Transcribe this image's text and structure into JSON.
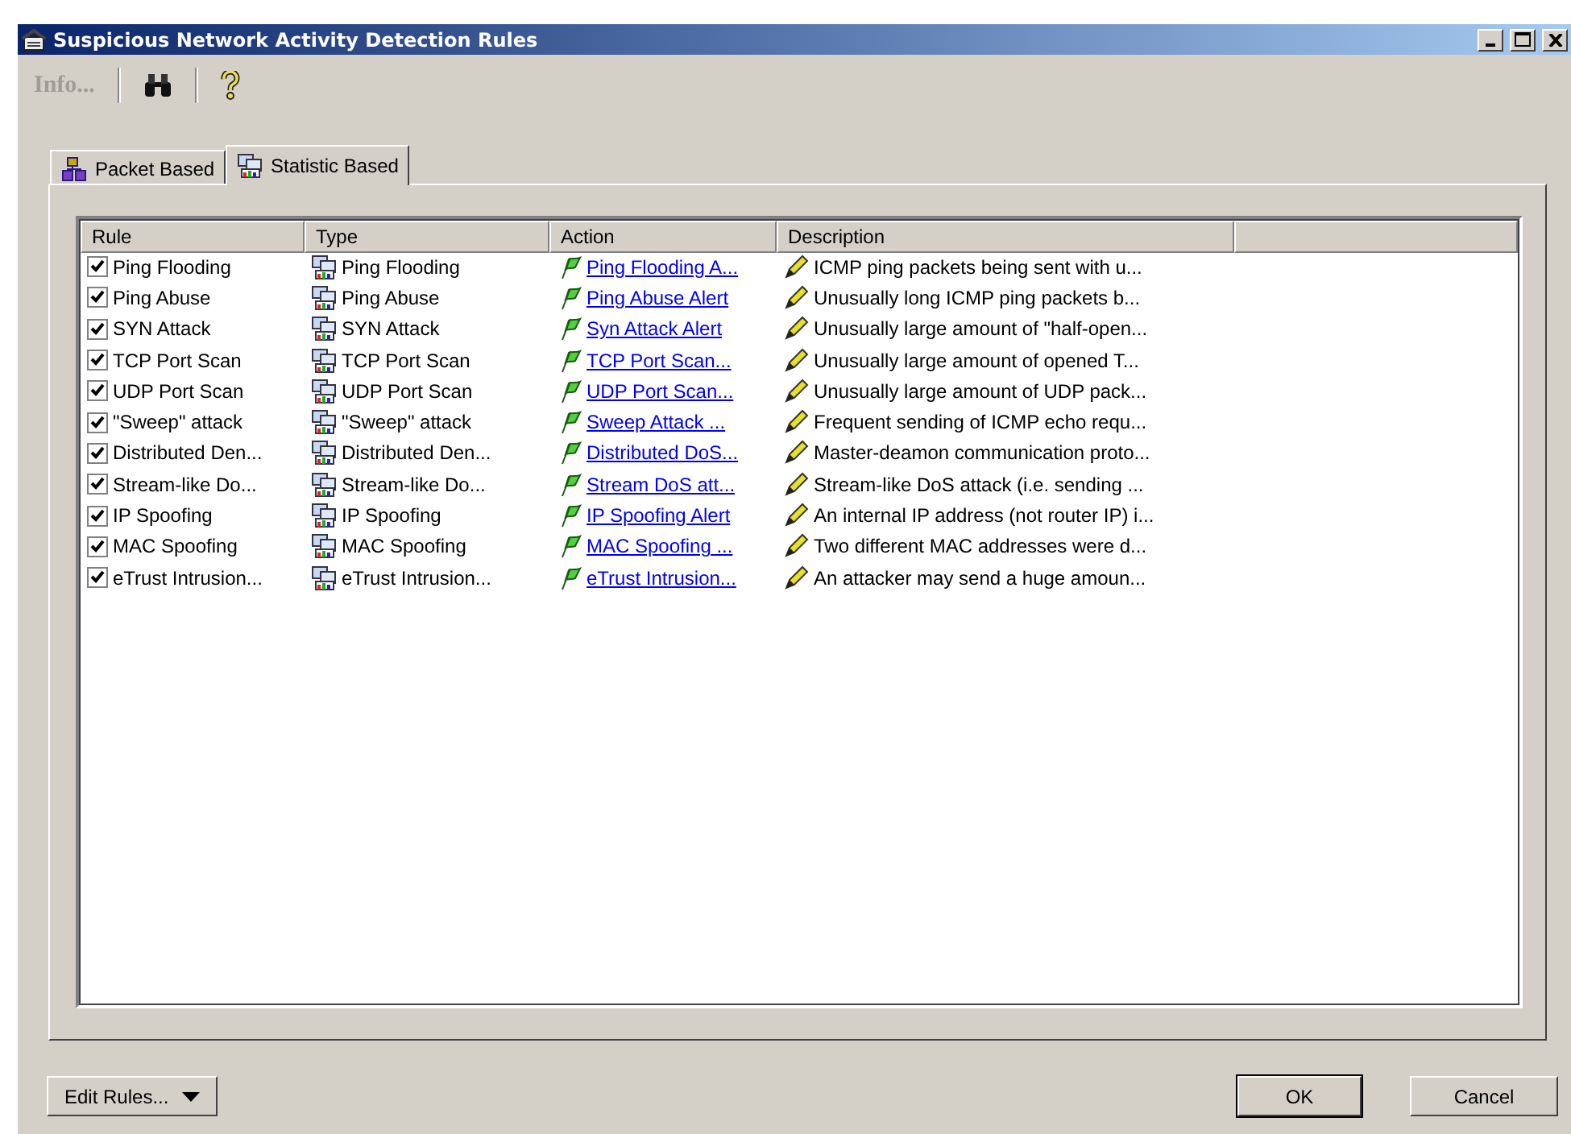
{
  "window": {
    "title": "Suspicious Network Activity Detection Rules"
  },
  "toolbar": {
    "info": {
      "label": "Info...",
      "disabled": true
    }
  },
  "tabs": [
    {
      "label": "Packet Based",
      "kind": "packet",
      "selected": false
    },
    {
      "label": "Statistic Based",
      "kind": "statistic",
      "selected": true
    }
  ],
  "table": {
    "columns": [
      "Rule",
      "Type",
      "Action",
      "Description"
    ],
    "rows": [
      {
        "rule": "Ping Flooding",
        "checked": true,
        "type": "Ping Flooding",
        "action": "Ping Flooding A...",
        "description": "ICMP ping packets being sent with u..."
      },
      {
        "rule": "Ping Abuse",
        "checked": true,
        "type": "Ping Abuse",
        "action": "Ping Abuse Alert",
        "description": "Unusually long ICMP ping packets b..."
      },
      {
        "rule": "SYN Attack",
        "checked": true,
        "type": "SYN Attack",
        "action": "Syn Attack Alert",
        "description": "Unusually large amount of \"half-open..."
      },
      {
        "rule": "TCP Port Scan",
        "checked": true,
        "type": "TCP Port Scan",
        "action": "TCP Port Scan...",
        "description": "Unusually large amount of opened T..."
      },
      {
        "rule": "UDP Port Scan",
        "checked": true,
        "type": "UDP Port Scan",
        "action": "UDP Port Scan...",
        "description": "Unusually large amount of UDP pack..."
      },
      {
        "rule": "\"Sweep\" attack",
        "checked": true,
        "type": "\"Sweep\" attack",
        "action": "Sweep Attack ...",
        "description": "Frequent sending of ICMP echo requ..."
      },
      {
        "rule": "Distributed Den...",
        "checked": true,
        "type": "Distributed Den...",
        "action": "Distributed DoS...",
        "description": "Master-deamon communication proto..."
      },
      {
        "rule": "Stream-like Do...",
        "checked": true,
        "type": "Stream-like Do...",
        "action": "Stream DoS att...",
        "description": "Stream-like DoS attack (i.e. sending ..."
      },
      {
        "rule": "IP Spoofing",
        "checked": true,
        "type": "IP Spoofing",
        "action": "IP Spoofing Alert",
        "description": "An internal IP address (not router IP) i..."
      },
      {
        "rule": "MAC Spoofing",
        "checked": true,
        "type": "MAC Spoofing",
        "action": "MAC Spoofing ...",
        "description": "Two different MAC addresses were d..."
      },
      {
        "rule": "eTrust Intrusion...",
        "checked": true,
        "type": "eTrust Intrusion...",
        "action": "eTrust Intrusion...",
        "description": "An attacker may send a huge amoun..."
      }
    ]
  },
  "buttons": {
    "edit": "Edit Rules...",
    "ok": "OK",
    "cancel": "Cancel"
  }
}
